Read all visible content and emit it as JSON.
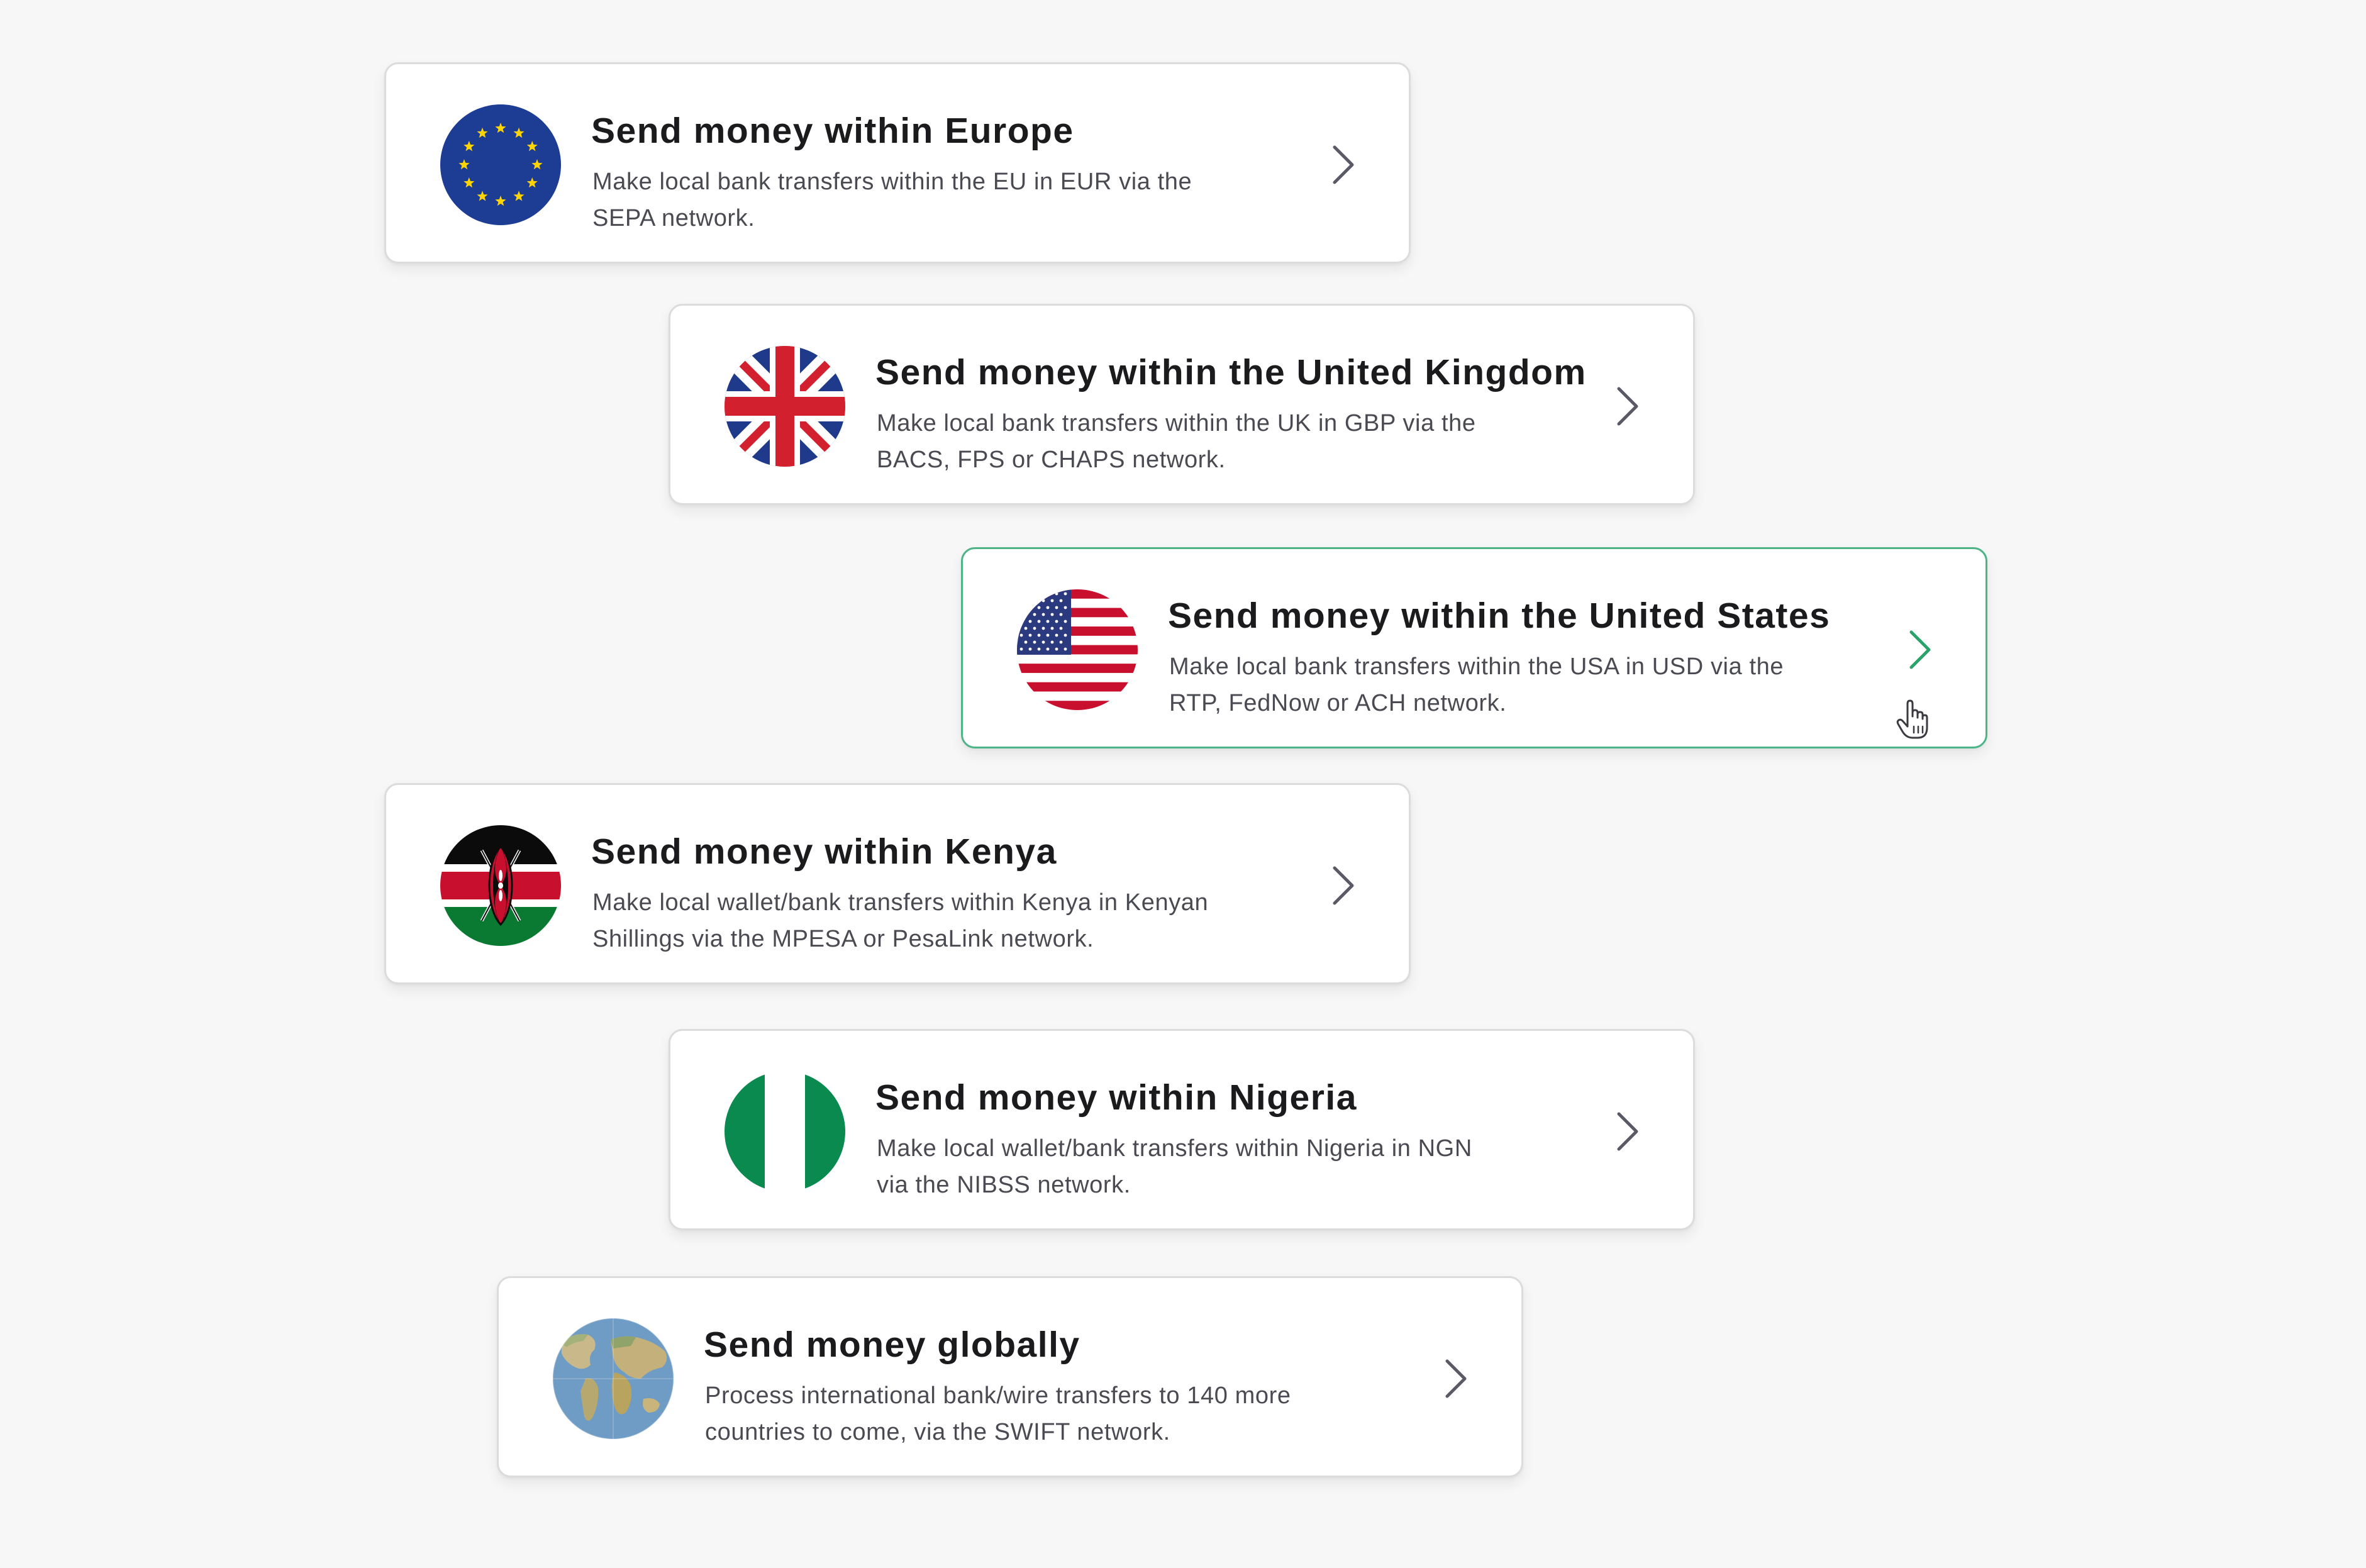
{
  "cards": [
    {
      "title": "Send money within Europe",
      "description": "Make local bank transfers within the EU in EUR via the SEPA network.",
      "flag_icon": "eu-flag-icon",
      "chevron_icon": "chevron-right-icon"
    },
    {
      "title": "Send money within the United Kingdom",
      "description": "Make local bank transfers within the UK in GBP via the BACS, FPS or CHAPS network.",
      "flag_icon": "uk-flag-icon",
      "chevron_icon": "chevron-right-icon"
    },
    {
      "title": "Send money within the United States",
      "description": "Make local bank transfers within the USA in USD via the RTP, FedNow or ACH network.",
      "flag_icon": "us-flag-icon",
      "chevron_icon": "chevron-right-icon",
      "state": "hovered",
      "cursor_icon": "hand-pointer-icon"
    },
    {
      "title": "Send money within Kenya",
      "description": "Make local wallet/bank transfers within Kenya in Kenyan Shillings via the MPESA or PesaLink network.",
      "flag_icon": "kenya-flag-icon",
      "chevron_icon": "chevron-right-icon"
    },
    {
      "title": "Send money within Nigeria",
      "description": "Make local wallet/bank transfers within Nigeria in NGN via the NIBSS network.",
      "flag_icon": "nigeria-flag-icon",
      "chevron_icon": "chevron-right-icon"
    },
    {
      "title": "Send money globally",
      "description": "Process international bank/wire transfers to 140 more countries to come, via the SWIFT network.",
      "flag_icon": "globe-icon",
      "chevron_icon": "chevron-right-icon"
    }
  ],
  "colors": {
    "background": "#f7f7f7",
    "card_background": "#ffffff",
    "card_border": "#dcdcdc",
    "active_border": "#4db487",
    "chevron": "#5a5a66",
    "chevron_active": "#2aa26a",
    "title": "#1b1b1d",
    "description": "#4a4a52"
  }
}
